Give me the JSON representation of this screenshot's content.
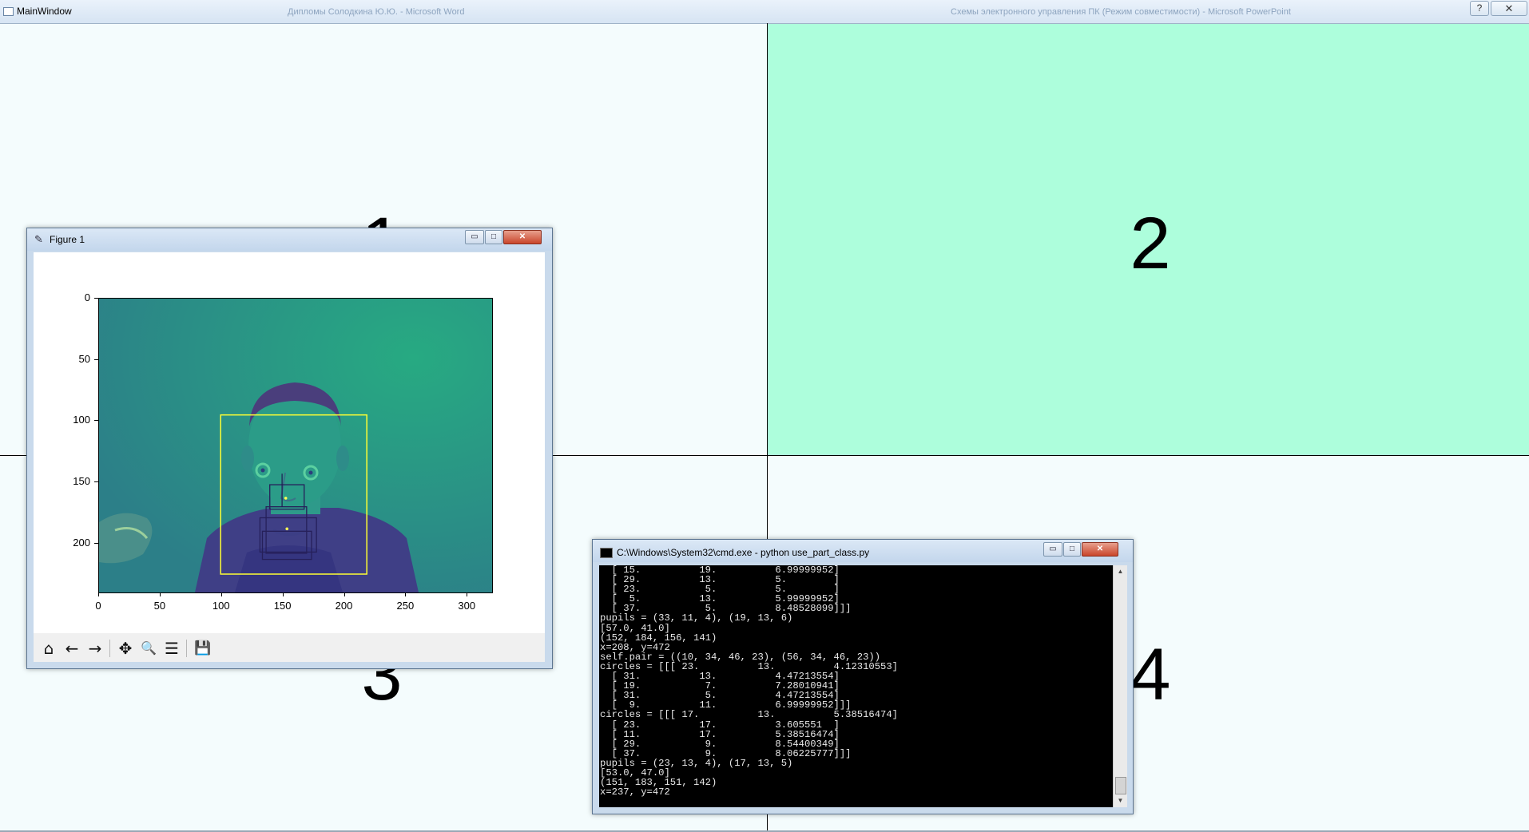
{
  "main_window": {
    "title": "MainWindow",
    "ghost_texts": [
      "Дипломы Солодкина Ю.Ю. - Microsoft Word",
      "Схемы электронного управления ПК (Режим совместимости) - Microsoft PowerPoint"
    ],
    "help_label": "?",
    "close_label": "✕",
    "quadrants": [
      {
        "number": "1",
        "color": "#f4fcfd"
      },
      {
        "number": "2",
        "color": "#adfedc"
      },
      {
        "number": "3",
        "color": "#f4fcfd"
      },
      {
        "number": "4",
        "color": "#f4fcfd"
      }
    ]
  },
  "figure_window": {
    "title": "Figure 1",
    "buttons": {
      "minimize": "▭",
      "maximize": "□",
      "close": "✕"
    },
    "toolbar": [
      {
        "name": "home-icon",
        "glyph": "⌂"
      },
      {
        "name": "back-arrow-icon",
        "glyph": "←"
      },
      {
        "name": "forward-arrow-icon",
        "glyph": "→"
      },
      {
        "name": "pan-icon",
        "glyph": "✥"
      },
      {
        "name": "zoom-icon",
        "glyph": "🔍"
      },
      {
        "name": "configure-subplots-icon",
        "glyph": "☰"
      },
      {
        "name": "save-icon",
        "glyph": "💾"
      }
    ],
    "plot": {
      "y_ticks": [
        "0",
        "50",
        "100",
        "150",
        "200"
      ],
      "x_ticks": [
        "0",
        "50",
        "100",
        "150",
        "200",
        "250",
        "300"
      ],
      "xlim": [
        0,
        320
      ],
      "ylim": [
        0,
        240
      ],
      "face_box": {
        "x": 99,
        "y": 95,
        "w": 119,
        "h": 130,
        "color": "#ffff33"
      },
      "mouth_boxes": [
        {
          "x": 139,
          "y": 152,
          "w": 28,
          "h": 20
        },
        {
          "x": 136,
          "y": 170,
          "w": 33,
          "h": 38
        },
        {
          "x": 131,
          "y": 179,
          "w": 46,
          "h": 28
        },
        {
          "x": 133,
          "y": 190,
          "w": 40,
          "h": 23
        }
      ]
    }
  },
  "cmd_window": {
    "title": "C:\\Windows\\System32\\cmd.exe - python  use_part_class.py",
    "buttons": {
      "minimize": "▭",
      "maximize": "□",
      "close": "✕"
    },
    "lines": [
      "  [ 15.          19.          6.99999952]",
      "  [ 29.          13.          5.        ]",
      "  [ 23.           5.          5.        ]",
      "  [  5.          13.          5.99999952]",
      "  [ 37.           5.          8.48528099]]]",
      "pupils = (33, 11, 4), (19, 13, 6)",
      "[57.0, 41.0]",
      "(152, 184, 156, 141)",
      "x=208, y=472",
      "self.pair = ((10, 34, 46, 23), (56, 34, 46, 23))",
      "circles = [[[ 23.          13.          4.12310553]",
      "  [ 31.          13.          4.47213554]",
      "  [ 19.           7.          7.28010941]",
      "  [ 31.           5.          4.47213554]",
      "  [  9.          11.          6.99999952]]]",
      "circles = [[[ 17.          13.          5.38516474]",
      "  [ 23.          17.          3.605551  ]",
      "  [ 11.          17.          5.38516474]",
      "  [ 29.           9.          8.54400349]",
      "  [ 37.           9.          8.06225777]]]",
      "pupils = (23, 13, 4), (17, 13, 5)",
      "[53.0, 47.0]",
      "(151, 183, 151, 142)",
      "x=237, y=472"
    ]
  }
}
